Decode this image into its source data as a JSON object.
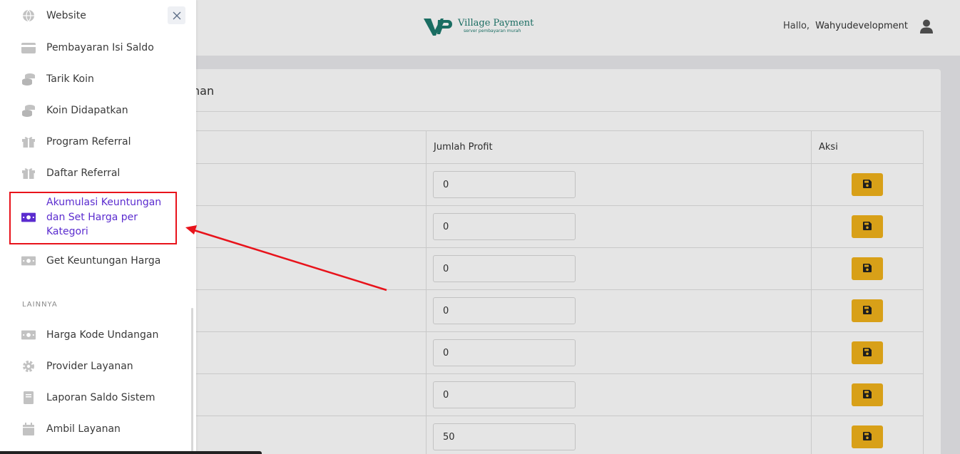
{
  "header": {
    "logo_title": "Village Payment",
    "logo_subtitle": "server pembayaran murah",
    "greeting": "Hallo,",
    "username": "Wahyudevelopment"
  },
  "card": {
    "title_partial": "nan",
    "columns": [
      "",
      "Jumlah Profit",
      "Aksi"
    ],
    "rows": [
      {
        "profit": "0"
      },
      {
        "profit": "0"
      },
      {
        "profit": "0"
      },
      {
        "profit": "0"
      },
      {
        "profit": "0"
      },
      {
        "profit": "0"
      },
      {
        "profit": "50"
      }
    ]
  },
  "sidebar": {
    "items": [
      {
        "label": "Website",
        "icon": "globe-icon"
      },
      {
        "label": "Pembayaran Isi Saldo",
        "icon": "credit-card-icon"
      },
      {
        "label": "Tarik Koin",
        "icon": "coins-icon"
      },
      {
        "label": "Koin Didapatkan",
        "icon": "coins-icon"
      },
      {
        "label": "Program Referral",
        "icon": "gift-icon"
      },
      {
        "label": "Daftar Referral",
        "icon": "gift-icon"
      },
      {
        "label": "Akumulasi Keuntungan dan Set Harga per Kategori",
        "icon": "money-bill-icon",
        "active": true
      },
      {
        "label": "Get Keuntungan Harga",
        "icon": "money-bill-icon"
      }
    ],
    "section_label": "LAINNYA",
    "other_items": [
      {
        "label": "Harga Kode Undangan",
        "icon": "money-bill-icon"
      },
      {
        "label": "Provider Layanan",
        "icon": "gear-icon"
      },
      {
        "label": "Laporan Saldo Sistem",
        "icon": "book-icon"
      },
      {
        "label": "Ambil Layanan",
        "icon": "calendar-icon"
      }
    ]
  },
  "colors": {
    "active_text": "#5b2ccf",
    "highlight": "#e8131b",
    "save_button": "#f1b31b",
    "brand": "#1d7a6e"
  }
}
